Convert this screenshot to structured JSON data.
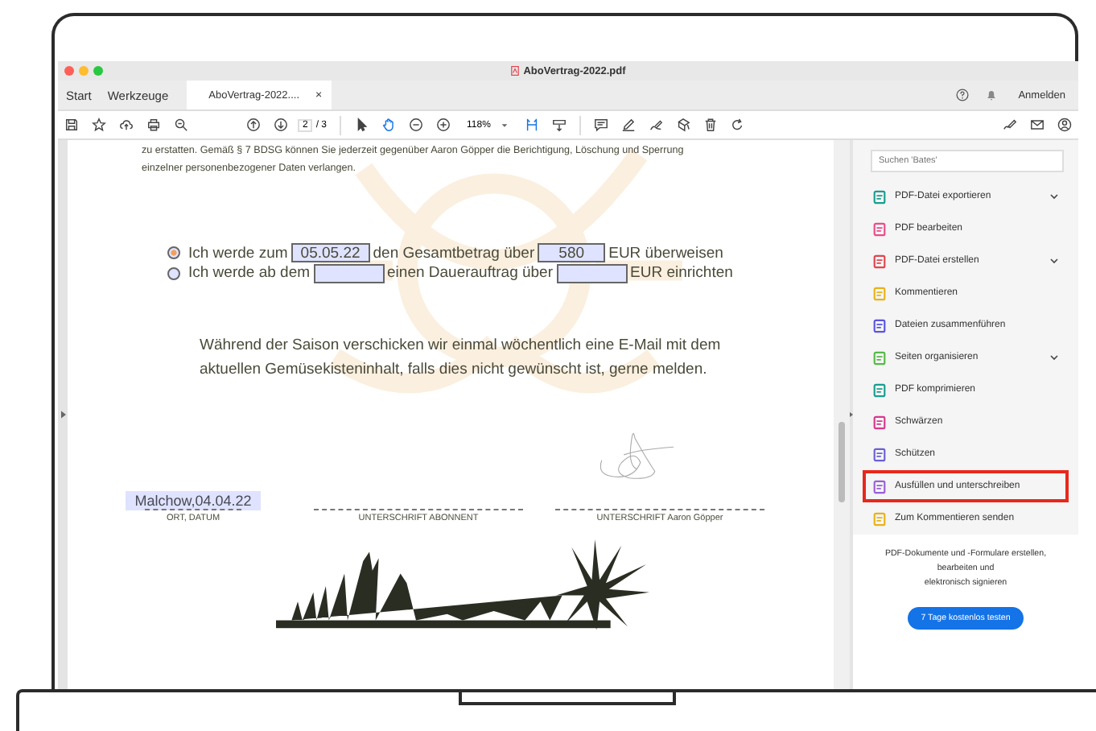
{
  "window": {
    "title": "AboVertrag-2022.pdf"
  },
  "nav": {
    "items": [
      {
        "label": "Start"
      },
      {
        "label": "Werkzeuge"
      }
    ],
    "tab": {
      "label": "AboVertrag-2022....",
      "close": "×",
      "selected": true
    },
    "sign_in": "Anmelden"
  },
  "toolbar": {
    "page": "2",
    "page_total": "/ 3",
    "zoom": "118%"
  },
  "document": {
    "intro": [
      "zu erstatten. Gemäß § 7 BDSG können Sie jederzeit gegenüber Aaron Göpper die Berichtigung, Löschung und Sperrung",
      "einzelner personenbezogener Daten verlangen."
    ],
    "options": [
      {
        "selected": true,
        "parts": [
          {
            "kind": "text",
            "text": "Ich werde zum"
          },
          {
            "kind": "field",
            "value": "05.05.22"
          },
          {
            "kind": "text",
            "text": "den Gesamtbetrag über"
          },
          {
            "kind": "field",
            "value": "580"
          },
          {
            "kind": "text",
            "text": "EUR überweisen"
          }
        ]
      },
      {
        "selected": false,
        "parts": [
          {
            "kind": "text",
            "text": "Ich werde ab dem"
          },
          {
            "kind": "field"
          },
          {
            "kind": "text",
            "text": "einen Dauerauftrag über"
          },
          {
            "kind": "field"
          },
          {
            "kind": "text",
            "text": "EUR einrichten"
          }
        ]
      }
    ],
    "notice": [
      "Während der Saison verschicken wir einmal wöchentlich eine E-Mail mit dem",
      "aktuellen Gemüsekisteninhalt, falls dies nicht gewünscht ist, gerne melden."
    ],
    "signatures": [
      {
        "value": "Malchow,04.04.22",
        "label": "ORT, DATUM",
        "signed": false
      },
      {
        "label": "UNTERSCHRIFT ABONNENT",
        "signed": false
      },
      {
        "label": "UNTERSCHRIFT Aaron Göpper",
        "signed": true
      }
    ]
  },
  "sidebar": {
    "search": {
      "placeholder": "Suchen 'Bates'"
    },
    "tools": [
      {
        "label": "PDF-Datei exportieren",
        "color": "#1a9e8f",
        "expandable": true,
        "selected": false
      },
      {
        "label": "PDF bearbeiten",
        "color": "#e84d8a",
        "expandable": false,
        "selected": false
      },
      {
        "label": "PDF-Datei erstellen",
        "color": "#e0454f",
        "expandable": true,
        "selected": false
      },
      {
        "label": "Kommentieren",
        "color": "#e8b21c",
        "expandable": false,
        "selected": false
      },
      {
        "label": "Dateien zusammenführen",
        "color": "#5a55e0",
        "expandable": false,
        "selected": false
      },
      {
        "label": "Seiten organisieren",
        "color": "#56b948",
        "expandable": true,
        "selected": false
      },
      {
        "label": "PDF komprimieren",
        "color": "#1a9e8f",
        "expandable": false,
        "selected": false
      },
      {
        "label": "Schwärzen",
        "color": "#d6398c",
        "expandable": false,
        "selected": false
      },
      {
        "label": "Schützen",
        "color": "#6b5fd6",
        "expandable": false,
        "selected": false
      },
      {
        "label": "Ausfüllen und unterschreiben",
        "color": "#9a5fd6",
        "expandable": false,
        "selected": true
      },
      {
        "label": "Zum Kommentieren senden",
        "color": "#e8b21c",
        "expandable": false,
        "selected": false
      }
    ],
    "promo": {
      "text": [
        "PDF-Dokumente und -Formulare erstellen,",
        "bearbeiten und",
        "elektronisch signieren"
      ],
      "button": "7 Tage kostenlos testen"
    }
  }
}
